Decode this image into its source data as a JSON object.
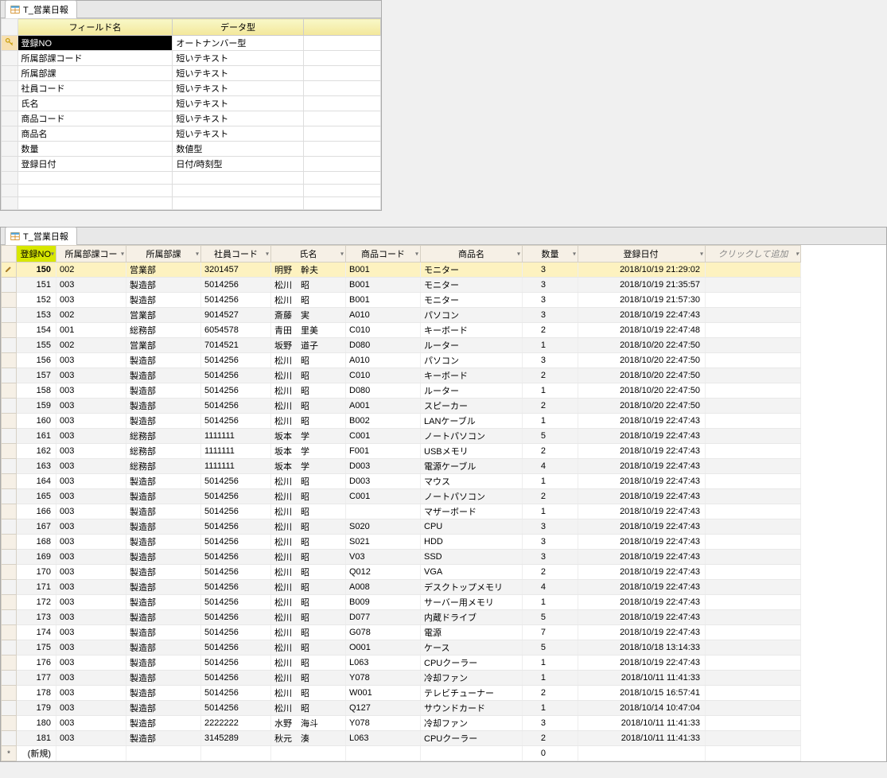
{
  "design": {
    "tab_title": "T_営業日報",
    "headers": {
      "field_name": "フィールド名",
      "data_type": "データ型"
    },
    "fields": [
      {
        "name": "登録NO",
        "type": "オートナンバー型",
        "pk": true
      },
      {
        "name": "所属部課コード",
        "type": "短いテキスト"
      },
      {
        "name": "所属部課",
        "type": "短いテキスト"
      },
      {
        "name": "社員コード",
        "type": "短いテキスト"
      },
      {
        "name": "氏名",
        "type": "短いテキスト"
      },
      {
        "name": "商品コード",
        "type": "短いテキスト"
      },
      {
        "name": "商品名",
        "type": "短いテキスト"
      },
      {
        "name": "数量",
        "type": "数値型"
      },
      {
        "name": "登録日付",
        "type": "日付/時刻型"
      }
    ]
  },
  "datasheet": {
    "tab_title": "T_営業日報",
    "headers": {
      "reg_no": "登録NO",
      "dept_code": "所属部課コー",
      "dept": "所属部課",
      "emp_code": "社員コード",
      "name": "氏名",
      "prod_code": "商品コード",
      "prod_name": "商品名",
      "qty": "数量",
      "reg_date": "登録日付",
      "add": "クリックして追加"
    },
    "new_row_label": "(新規)",
    "new_row_qty": "0",
    "selected_regno": "150",
    "rows": [
      {
        "reg_no": "150",
        "dept_code": "002",
        "dept": "営業部",
        "emp_code": "3201457",
        "name": "明野　幹夫",
        "prod_code": "B001",
        "prod_name": "モニター",
        "qty": "3",
        "reg_date": "2018/10/19 21:29:02"
      },
      {
        "reg_no": "151",
        "dept_code": "003",
        "dept": "製造部",
        "emp_code": "5014256",
        "name": "松川　昭",
        "prod_code": "B001",
        "prod_name": "モニター",
        "qty": "3",
        "reg_date": "2018/10/19 21:35:57"
      },
      {
        "reg_no": "152",
        "dept_code": "003",
        "dept": "製造部",
        "emp_code": "5014256",
        "name": "松川　昭",
        "prod_code": "B001",
        "prod_name": "モニター",
        "qty": "3",
        "reg_date": "2018/10/19 21:57:30"
      },
      {
        "reg_no": "153",
        "dept_code": "002",
        "dept": "営業部",
        "emp_code": "9014527",
        "name": "斎藤　実",
        "prod_code": "A010",
        "prod_name": "パソコン",
        "qty": "3",
        "reg_date": "2018/10/19 22:47:43"
      },
      {
        "reg_no": "154",
        "dept_code": "001",
        "dept": "総務部",
        "emp_code": "6054578",
        "name": "青田　里美",
        "prod_code": "C010",
        "prod_name": "キーボード",
        "qty": "2",
        "reg_date": "2018/10/19 22:47:48"
      },
      {
        "reg_no": "155",
        "dept_code": "002",
        "dept": "営業部",
        "emp_code": "7014521",
        "name": "坂野　道子",
        "prod_code": "D080",
        "prod_name": "ルーター",
        "qty": "1",
        "reg_date": "2018/10/20 22:47:50"
      },
      {
        "reg_no": "156",
        "dept_code": "003",
        "dept": "製造部",
        "emp_code": "5014256",
        "name": "松川　昭",
        "prod_code": "A010",
        "prod_name": "パソコン",
        "qty": "3",
        "reg_date": "2018/10/20 22:47:50"
      },
      {
        "reg_no": "157",
        "dept_code": "003",
        "dept": "製造部",
        "emp_code": "5014256",
        "name": "松川　昭",
        "prod_code": "C010",
        "prod_name": "キーボード",
        "qty": "2",
        "reg_date": "2018/10/20 22:47:50"
      },
      {
        "reg_no": "158",
        "dept_code": "003",
        "dept": "製造部",
        "emp_code": "5014256",
        "name": "松川　昭",
        "prod_code": "D080",
        "prod_name": "ルーター",
        "qty": "1",
        "reg_date": "2018/10/20 22:47:50"
      },
      {
        "reg_no": "159",
        "dept_code": "003",
        "dept": "製造部",
        "emp_code": "5014256",
        "name": "松川　昭",
        "prod_code": "A001",
        "prod_name": "スピーカー",
        "qty": "2",
        "reg_date": "2018/10/20 22:47:50"
      },
      {
        "reg_no": "160",
        "dept_code": "003",
        "dept": "製造部",
        "emp_code": "5014256",
        "name": "松川　昭",
        "prod_code": "B002",
        "prod_name": "LANケーブル",
        "qty": "1",
        "reg_date": "2018/10/19 22:47:43"
      },
      {
        "reg_no": "161",
        "dept_code": "003",
        "dept": "総務部",
        "emp_code": "1111111",
        "name": "坂本　学",
        "prod_code": "C001",
        "prod_name": "ノートパソコン",
        "qty": "5",
        "reg_date": "2018/10/19 22:47:43"
      },
      {
        "reg_no": "162",
        "dept_code": "003",
        "dept": "総務部",
        "emp_code": "1111111",
        "name": "坂本　学",
        "prod_code": "F001",
        "prod_name": "USBメモリ",
        "qty": "2",
        "reg_date": "2018/10/19 22:47:43"
      },
      {
        "reg_no": "163",
        "dept_code": "003",
        "dept": "総務部",
        "emp_code": "1111111",
        "name": "坂本　学",
        "prod_code": "D003",
        "prod_name": "電源ケーブル",
        "qty": "4",
        "reg_date": "2018/10/19 22:47:43"
      },
      {
        "reg_no": "164",
        "dept_code": "003",
        "dept": "製造部",
        "emp_code": "5014256",
        "name": "松川　昭",
        "prod_code": "D003",
        "prod_name": "マウス",
        "qty": "1",
        "reg_date": "2018/10/19 22:47:43"
      },
      {
        "reg_no": "165",
        "dept_code": "003",
        "dept": "製造部",
        "emp_code": "5014256",
        "name": "松川　昭",
        "prod_code": "C001",
        "prod_name": "ノートパソコン",
        "qty": "2",
        "reg_date": "2018/10/19 22:47:43"
      },
      {
        "reg_no": "166",
        "dept_code": "003",
        "dept": "製造部",
        "emp_code": "5014256",
        "name": "松川　昭",
        "prod_code": "",
        "prod_name": "マザーボード",
        "qty": "1",
        "reg_date": "2018/10/19 22:47:43"
      },
      {
        "reg_no": "167",
        "dept_code": "003",
        "dept": "製造部",
        "emp_code": "5014256",
        "name": "松川　昭",
        "prod_code": "S020",
        "prod_name": "CPU",
        "qty": "3",
        "reg_date": "2018/10/19 22:47:43"
      },
      {
        "reg_no": "168",
        "dept_code": "003",
        "dept": "製造部",
        "emp_code": "5014256",
        "name": "松川　昭",
        "prod_code": "S021",
        "prod_name": "HDD",
        "qty": "3",
        "reg_date": "2018/10/19 22:47:43"
      },
      {
        "reg_no": "169",
        "dept_code": "003",
        "dept": "製造部",
        "emp_code": "5014256",
        "name": "松川　昭",
        "prod_code": "V03",
        "prod_name": "SSD",
        "qty": "3",
        "reg_date": "2018/10/19 22:47:43"
      },
      {
        "reg_no": "170",
        "dept_code": "003",
        "dept": "製造部",
        "emp_code": "5014256",
        "name": "松川　昭",
        "prod_code": "Q012",
        "prod_name": "VGA",
        "qty": "2",
        "reg_date": "2018/10/19 22:47:43"
      },
      {
        "reg_no": "171",
        "dept_code": "003",
        "dept": "製造部",
        "emp_code": "5014256",
        "name": "松川　昭",
        "prod_code": "A008",
        "prod_name": "デスクトップメモリ",
        "qty": "4",
        "reg_date": "2018/10/19 22:47:43"
      },
      {
        "reg_no": "172",
        "dept_code": "003",
        "dept": "製造部",
        "emp_code": "5014256",
        "name": "松川　昭",
        "prod_code": "B009",
        "prod_name": "サーバー用メモリ",
        "qty": "1",
        "reg_date": "2018/10/19 22:47:43"
      },
      {
        "reg_no": "173",
        "dept_code": "003",
        "dept": "製造部",
        "emp_code": "5014256",
        "name": "松川　昭",
        "prod_code": "D077",
        "prod_name": "内蔵ドライブ",
        "qty": "5",
        "reg_date": "2018/10/19 22:47:43"
      },
      {
        "reg_no": "174",
        "dept_code": "003",
        "dept": "製造部",
        "emp_code": "5014256",
        "name": "松川　昭",
        "prod_code": "G078",
        "prod_name": "電源",
        "qty": "7",
        "reg_date": "2018/10/19 22:47:43"
      },
      {
        "reg_no": "175",
        "dept_code": "003",
        "dept": "製造部",
        "emp_code": "5014256",
        "name": "松川　昭",
        "prod_code": "O001",
        "prod_name": "ケース",
        "qty": "5",
        "reg_date": "2018/10/18 13:14:33"
      },
      {
        "reg_no": "176",
        "dept_code": "003",
        "dept": "製造部",
        "emp_code": "5014256",
        "name": "松川　昭",
        "prod_code": "L063",
        "prod_name": "CPUクーラー",
        "qty": "1",
        "reg_date": "2018/10/19 22:47:43"
      },
      {
        "reg_no": "177",
        "dept_code": "003",
        "dept": "製造部",
        "emp_code": "5014256",
        "name": "松川　昭",
        "prod_code": "Y078",
        "prod_name": "冷却ファン",
        "qty": "1",
        "reg_date": "2018/10/11 11:41:33"
      },
      {
        "reg_no": "178",
        "dept_code": "003",
        "dept": "製造部",
        "emp_code": "5014256",
        "name": "松川　昭",
        "prod_code": "W001",
        "prod_name": "テレビチューナー",
        "qty": "2",
        "reg_date": "2018/10/15 16:57:41"
      },
      {
        "reg_no": "179",
        "dept_code": "003",
        "dept": "製造部",
        "emp_code": "5014256",
        "name": "松川　昭",
        "prod_code": "Q127",
        "prod_name": "サウンドカード",
        "qty": "1",
        "reg_date": "2018/10/14 10:47:04"
      },
      {
        "reg_no": "180",
        "dept_code": "003",
        "dept": "製造部",
        "emp_code": "2222222",
        "name": "水野　海斗",
        "prod_code": "Y078",
        "prod_name": "冷却ファン",
        "qty": "3",
        "reg_date": "2018/10/11 11:41:33"
      },
      {
        "reg_no": "181",
        "dept_code": "003",
        "dept": "製造部",
        "emp_code": "3145289",
        "name": "秋元　湊",
        "prod_code": "L063",
        "prod_name": "CPUクーラー",
        "qty": "2",
        "reg_date": "2018/10/11 11:41:33"
      }
    ]
  }
}
